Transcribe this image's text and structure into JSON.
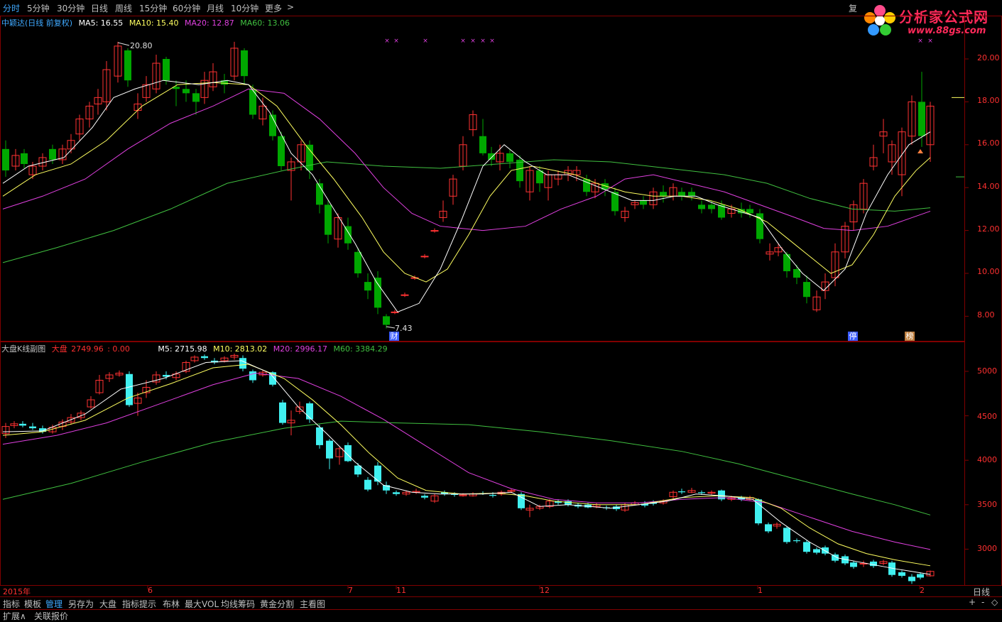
{
  "top_tabs": [
    "分时",
    "5分钟",
    "30分钟",
    "日线",
    "周线",
    "15分钟",
    "60分钟",
    "月线",
    "10分钟",
    "更多"
  ],
  "top_more_arrow": ">",
  "restore_label": "复",
  "logo": {
    "name": "分析家公式网",
    "url": "www.88gs.com"
  },
  "main_legend": {
    "title": "中颖达(日线 前复权)",
    "ma5": "MA5: 16.55",
    "ma10": "MA10: 15.40",
    "ma20": "MA20: 12.87",
    "ma60": "MA60: 13.06"
  },
  "main_axis": [
    "20.00",
    "18.00",
    "16.00",
    "14.00",
    "12.00",
    "10.00",
    "8.00"
  ],
  "main_annotations": {
    "high": "20.80",
    "low": "7.43"
  },
  "sub_legend": {
    "title": "大盘K线副图",
    "index_label": "大盘",
    "index_value": "2749.96",
    "index_change": ": 0.00",
    "m5": "M5: 2715.98",
    "m10": "M10: 2813.02",
    "m20": "M20: 2996.17",
    "m60": "M60: 3384.29"
  },
  "sub_axis": [
    "5000",
    "4500",
    "4000",
    "3500",
    "3000"
  ],
  "date_labels": [
    "2015年",
    "6",
    "7",
    "11",
    "12",
    "1",
    "2"
  ],
  "period_label": "日线",
  "markers": {
    "cai": "财",
    "ting": "停",
    "bang": "榜"
  },
  "bottom_tabs": [
    "指标",
    "模板",
    "管理",
    "另存为",
    "大盘",
    "指标提示",
    "布林",
    "最大VOL",
    "均线筹码",
    "黄金分割",
    "主看图"
  ],
  "zoom_controls": [
    "+",
    "-",
    "◇"
  ],
  "status_items": [
    "扩展∧",
    "关联报价"
  ],
  "colors": {
    "up": "#ff3232",
    "down_main": "#00a800",
    "down_sub": "#40f0f0",
    "ma5": "#ffffff",
    "ma10": "#ffff60",
    "ma20": "#e040e0",
    "ma60": "#40c040",
    "border": "#800000",
    "axis_text": "#ff3030",
    "accent": "#3fa9ff"
  }
}
